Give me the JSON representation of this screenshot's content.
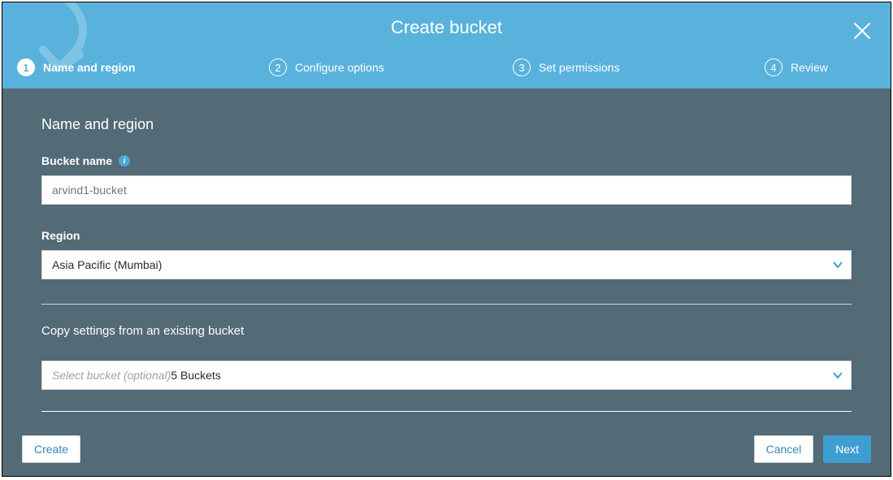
{
  "modal": {
    "title": "Create bucket"
  },
  "steps": [
    {
      "num": "1",
      "label": "Name and region"
    },
    {
      "num": "2",
      "label": "Configure options"
    },
    {
      "num": "3",
      "label": "Set permissions"
    },
    {
      "num": "4",
      "label": "Review"
    }
  ],
  "form": {
    "section_title": "Name and region",
    "bucket_name_label": "Bucket name",
    "bucket_name_value": "arvind1-bucket",
    "region_label": "Region",
    "region_value": "Asia Pacific (Mumbai)",
    "copy_label": "Copy settings from an existing bucket",
    "copy_placeholder": "Select bucket (optional)",
    "copy_count": "5 Buckets"
  },
  "footer": {
    "create_label": "Create",
    "cancel_label": "Cancel",
    "next_label": "Next"
  }
}
